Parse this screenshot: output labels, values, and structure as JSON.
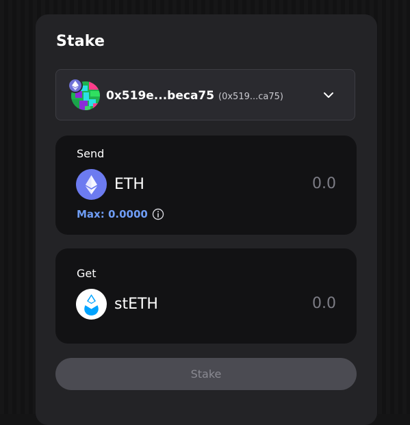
{
  "title": "Stake",
  "account": {
    "name": "0x519e...beca75",
    "short_address": "(0x519...ca75)"
  },
  "send": {
    "label": "Send",
    "token": "ETH",
    "amount_placeholder": "0.0",
    "max_label": "Max: 0.0000"
  },
  "get": {
    "label": "Get",
    "token": "stETH",
    "amount_placeholder": "0.0"
  },
  "stake_button_label": "Stake",
  "colors": {
    "accent_link": "#6f9df6",
    "eth_icon": "#6c7bf0",
    "steth_drop": "#00a3ff",
    "button_disabled": "#4b4b52"
  },
  "icons": [
    "ethereum-icon",
    "steth-icon",
    "chevron-down-icon",
    "info-icon",
    "account-avatar"
  ]
}
